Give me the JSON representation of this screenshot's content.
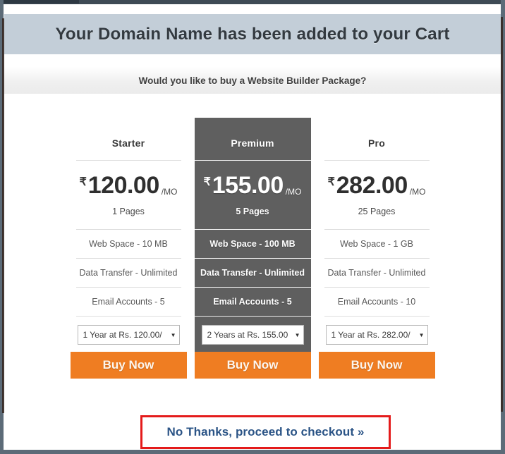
{
  "banner": {
    "title": "Your Domain Name has been added to your Cart"
  },
  "question": {
    "text": "Would you like to buy a Website Builder Package?"
  },
  "plans": [
    {
      "name": "Starter",
      "currency": "₹",
      "amount": "120.00",
      "per": "/MO",
      "pages": "1 Pages",
      "features": [
        "Web Space - 10 MB",
        "Data Transfer - Unlimited",
        "Email Accounts - 5"
      ],
      "term_selected": "1 Year at Rs. 120.00/",
      "caret": "▼",
      "buy_label": "Buy Now",
      "featured": false
    },
    {
      "name": "Premium",
      "currency": "₹",
      "amount": "155.00",
      "per": "/MO",
      "pages": "5 Pages",
      "features": [
        "Web Space - 100 MB",
        "Data Transfer - Unlimited",
        "Email Accounts - 5"
      ],
      "term_selected": "2 Years at Rs. 155.00",
      "caret": "▼",
      "buy_label": "Buy Now",
      "featured": true
    },
    {
      "name": "Pro",
      "currency": "₹",
      "amount": "282.00",
      "per": "/MO",
      "pages": "25 Pages",
      "features": [
        "Web Space - 1 GB",
        "Data Transfer - Unlimited",
        "Email Accounts - 10"
      ],
      "term_selected": "1 Year at Rs. 282.00/",
      "caret": "▼",
      "buy_label": "Buy Now",
      "featured": false
    }
  ],
  "checkout": {
    "label": "No Thanks, proceed to checkout »"
  },
  "colors": {
    "banner_bg": "#c3ced8",
    "featured_bg": "#5f5f5f",
    "buy_button": "#ef7d22",
    "checkout_border": "#e41b1b",
    "checkout_link": "#2b5486",
    "chrome": "#5c6b78"
  }
}
